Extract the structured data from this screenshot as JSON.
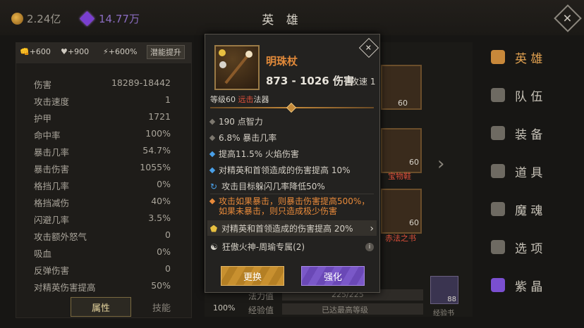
{
  "topbar": {
    "gold": "2.24亿",
    "gems": "14.77万",
    "title": "英 雄"
  },
  "left": {
    "buffs": [
      "+600",
      "+900",
      "+600%"
    ],
    "potential_button": "潜能提升",
    "stats": [
      [
        "伤害",
        "18289-18442"
      ],
      [
        "攻击速度",
        "1"
      ],
      [
        "护甲",
        "1721"
      ],
      [
        "命中率",
        "100%"
      ],
      [
        "暴击几率",
        "54.7%"
      ],
      [
        "暴击伤害",
        "1055%"
      ],
      [
        "格挡几率",
        "0%"
      ],
      [
        "格挡减伤",
        "40%"
      ],
      [
        "闪避几率",
        "3.5%"
      ],
      [
        "攻击额外怒气",
        "0"
      ],
      [
        "吸血",
        "0%"
      ],
      [
        "反弹伤害",
        "0"
      ],
      [
        "对精英伤害提高",
        "50%"
      ]
    ],
    "tabs": [
      "属性",
      "技能"
    ]
  },
  "nav": [
    "英 雄",
    "队 伍",
    "装 备",
    "道 具",
    "魔 魂",
    "选 项",
    "紫 晶"
  ],
  "center": {
    "card_levels": [
      "60",
      "60",
      "60"
    ],
    "card_labels": [
      "宝物鞋",
      "赤法之书"
    ],
    "bottom": {
      "percent": "100%",
      "mana_label": "法力值",
      "mana_value": "225/225",
      "exp_label": "经验值",
      "exp_value": "已达最高等级",
      "book_label": "经验书",
      "book_count": "88"
    }
  },
  "modal": {
    "name": "明珠杖",
    "damage": "873 - 1026 伤害",
    "speed": "攻速 1",
    "level_prefix": "等级60 ",
    "level_type": "远击",
    "level_suffix": "法器",
    "lines": [
      "190 点智力",
      "6.8% 暴击几率",
      "提高11.5% 火焰伤害",
      "对精英和首领造成的伤害提高 10%",
      "攻击目标躲闪几率降低50%",
      "攻击如果暴击，则暴击伤害提高500%，如果未暴击，则只造成极少伤害",
      "对精英和首领造成的伤害提高 20%",
      "狂傲火神-周瑜专属(2)"
    ],
    "btn_replace": "更换",
    "btn_enhance": "强化"
  },
  "colors": {
    "accent_orange": "#e28a3a",
    "gold_btn": "#c8902f",
    "purple_btn": "#7a58c8"
  }
}
